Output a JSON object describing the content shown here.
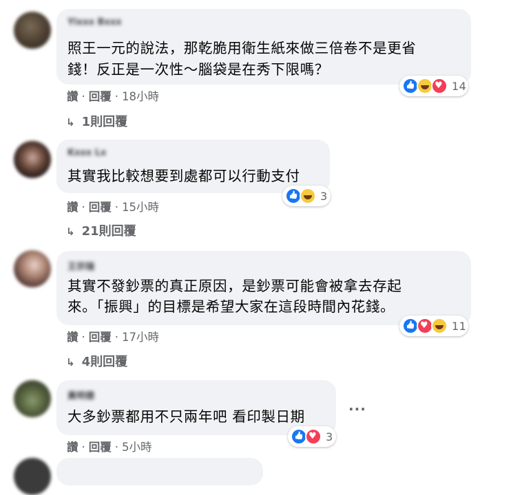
{
  "comments": [
    {
      "author": "Yixxx Bxxx",
      "lines": [
        "照王一元的說法，那乾脆用衛生紙來做三倍卷不是更省",
        "錢！反正是一次性～腦袋是在秀下限嗎？"
      ],
      "reactions": [
        "like-icon",
        "haha-icon",
        "love-icon"
      ],
      "reaction_count": "14",
      "actions": {
        "like": "讚",
        "reply": "回覆",
        "time": "18小時"
      },
      "replies": "1則回覆"
    },
    {
      "author": "Kxxx Lx",
      "lines": [
        "其實我比較想要到處都可以行動支付"
      ],
      "reactions": [
        "like-icon",
        "haha-icon"
      ],
      "reaction_count": "3",
      "actions": {
        "like": "讚",
        "reply": "回覆",
        "time": "15小時"
      },
      "replies": "21則回覆"
    },
    {
      "author": "王宗瑞",
      "lines": [
        "其實不發鈔票的真正原因，是鈔票可能會被拿去存起",
        "來。「振興」的目標是希望大家在這段時間內花錢。"
      ],
      "reactions": [
        "like-icon",
        "love-icon",
        "haha-icon"
      ],
      "reaction_count": "11",
      "actions": {
        "like": "讚",
        "reply": "回覆",
        "time": "17小時"
      },
      "replies": "4則回覆"
    },
    {
      "author": "黃明德",
      "lines": [
        "大多鈔票都用不只兩年吧 看印製日期"
      ],
      "reactions": [
        "like-icon",
        "love-icon"
      ],
      "reaction_count": "3",
      "actions": {
        "like": "讚",
        "reply": "回覆",
        "time": "5小時"
      },
      "more": "···"
    }
  ],
  "colors": {
    "bubble": "#f0f2f5",
    "meta": "#65676b",
    "like": "#1877f2",
    "love": "#f33e58",
    "haha": "#f7c93e"
  }
}
